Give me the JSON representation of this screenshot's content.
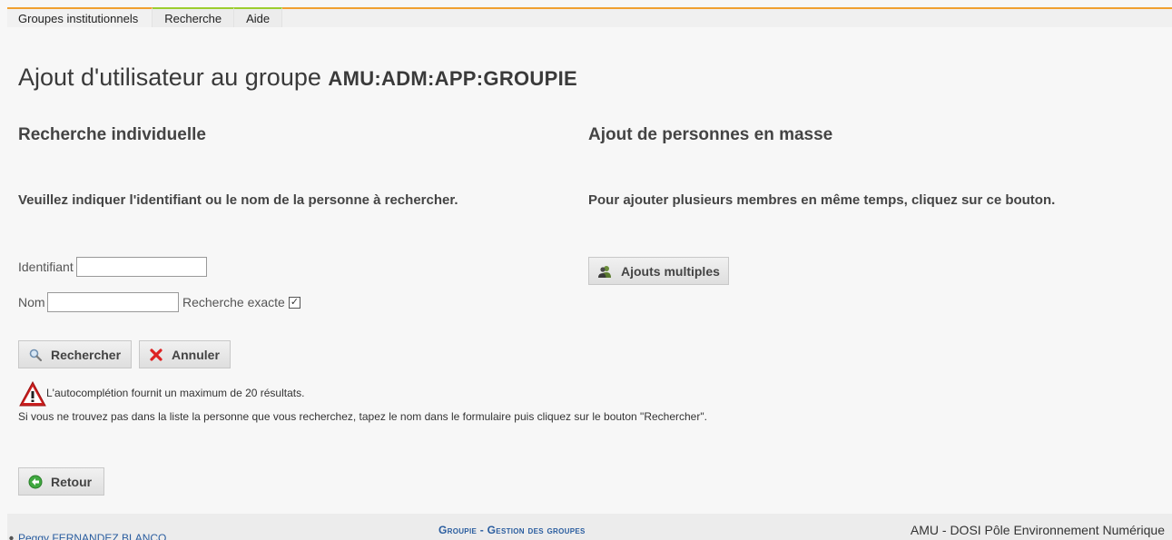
{
  "tabs": [
    {
      "label": "Groupes institutionnels"
    },
    {
      "label": "Recherche"
    },
    {
      "label": "Aide"
    }
  ],
  "page": {
    "title_prefix": "Ajout d'utilisateur au groupe",
    "group_name": "AMU:ADM:APP:GROUPIE"
  },
  "individual": {
    "heading": "Recherche individuelle",
    "instruction": "Veuillez indiquer l'identifiant ou le nom de la personne à rechercher.",
    "id_label": "Identifiant",
    "id_value": "",
    "name_label": "Nom",
    "name_value": "",
    "exact_label": "Recherche exacte",
    "exact_checked": true,
    "search_button": "Rechercher",
    "cancel_button": "Annuler",
    "autocomplete_note": "L'autocomplétion fournit un maximum de 20 résultats.",
    "help_note": "Si vous ne trouvez pas dans la liste la personne que vous recherchez, tapez le nom dans le formulaire puis cliquez sur le bouton \"Rechercher\".",
    "back_button": "Retour"
  },
  "mass": {
    "heading": "Ajout de personnes en masse",
    "instruction": "Pour ajouter plusieurs membres en même temps, cliquez sur ce bouton.",
    "multi_button": "Ajouts multiples"
  },
  "footer": {
    "user": "Peggy FERNANDEZ BLANCO",
    "app_title": "Groupie - Gestion des groupes",
    "org": "AMU - DOSI Pôle Environnement Numérique"
  },
  "colors": {
    "accent_orange": "#f0a030",
    "accent_green": "#9ccd2f",
    "link_blue": "#2a5d9f",
    "warning_red": "#cc1f1f"
  }
}
